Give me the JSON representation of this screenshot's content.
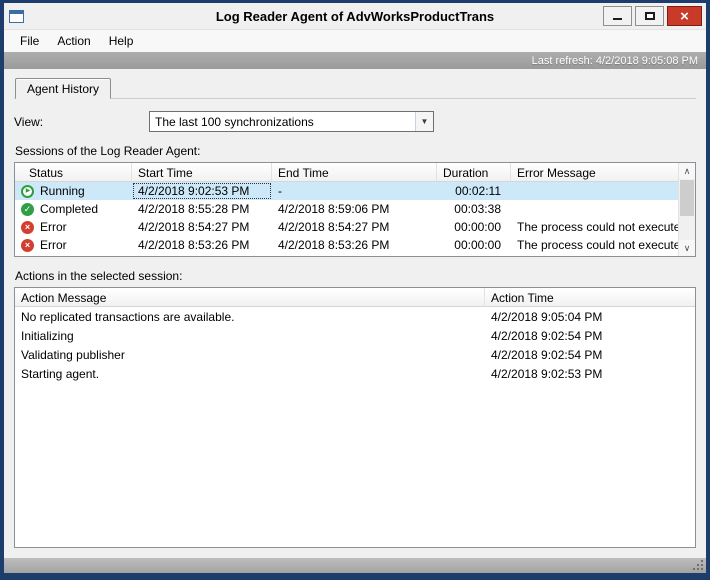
{
  "titlebar": {
    "title": "Log Reader Agent of AdvWorksProductTrans",
    "icon": "application-window-icon",
    "controls": {
      "minimize": "minimize",
      "maximize": "maximize",
      "close": "close"
    }
  },
  "menu": {
    "file": "File",
    "action": "Action",
    "help": "Help"
  },
  "refresh": {
    "text": "Last refresh: 4/2/2018 9:05:08 PM"
  },
  "tab": {
    "label": "Agent History"
  },
  "view": {
    "label": "View:",
    "value": "The last 100 synchronizations",
    "dropdown_icon": "chevron-down-icon"
  },
  "sessions": {
    "caption": "Sessions of the Log Reader Agent:",
    "columns": {
      "status": "Status",
      "start": "Start Time",
      "end": "End Time",
      "duration": "Duration",
      "error": "Error Message"
    },
    "rows": [
      {
        "icon": "running-icon",
        "status": "Running",
        "start": "4/2/2018 9:02:53 PM",
        "end": "-",
        "duration": "00:02:11",
        "error": "",
        "selected": true
      },
      {
        "icon": "completed-icon",
        "status": "Completed",
        "start": "4/2/2018 8:55:28 PM",
        "end": "4/2/2018 8:59:06 PM",
        "duration": "00:03:38",
        "error": "",
        "selected": false
      },
      {
        "icon": "error-icon",
        "status": "Error",
        "start": "4/2/2018 8:54:27 PM",
        "end": "4/2/2018 8:54:27 PM",
        "duration": "00:00:00",
        "error": "The process could not execute '...",
        "selected": false
      },
      {
        "icon": "error-icon",
        "status": "Error",
        "start": "4/2/2018 8:53:26 PM",
        "end": "4/2/2018 8:53:26 PM",
        "duration": "00:00:00",
        "error": "The process could not execute '...",
        "selected": false
      }
    ],
    "scrollbar": {
      "up_icon": "∧",
      "down_icon": "∨"
    }
  },
  "actions": {
    "caption": "Actions in the selected session:",
    "columns": {
      "message": "Action Message",
      "time": "Action Time"
    },
    "rows": [
      {
        "message": "No replicated transactions are available.",
        "time": "4/2/2018 9:05:04 PM"
      },
      {
        "message": "Initializing",
        "time": "4/2/2018 9:02:54 PM"
      },
      {
        "message": "Validating publisher",
        "time": "4/2/2018 9:02:54 PM"
      },
      {
        "message": "Starting agent.",
        "time": "4/2/2018 9:02:53 PM"
      }
    ]
  },
  "colors": {
    "frame_border": "#1d3e6d",
    "selection": "#cde8f8",
    "close_button": "#ca3a28",
    "running_green": "#2d9d3e",
    "completed_green": "#2f9e44",
    "error_red": "#d23f31"
  },
  "glyphs": {
    "running": "▶",
    "completed": "✓",
    "error": "×",
    "combo_arrow": "▼"
  }
}
